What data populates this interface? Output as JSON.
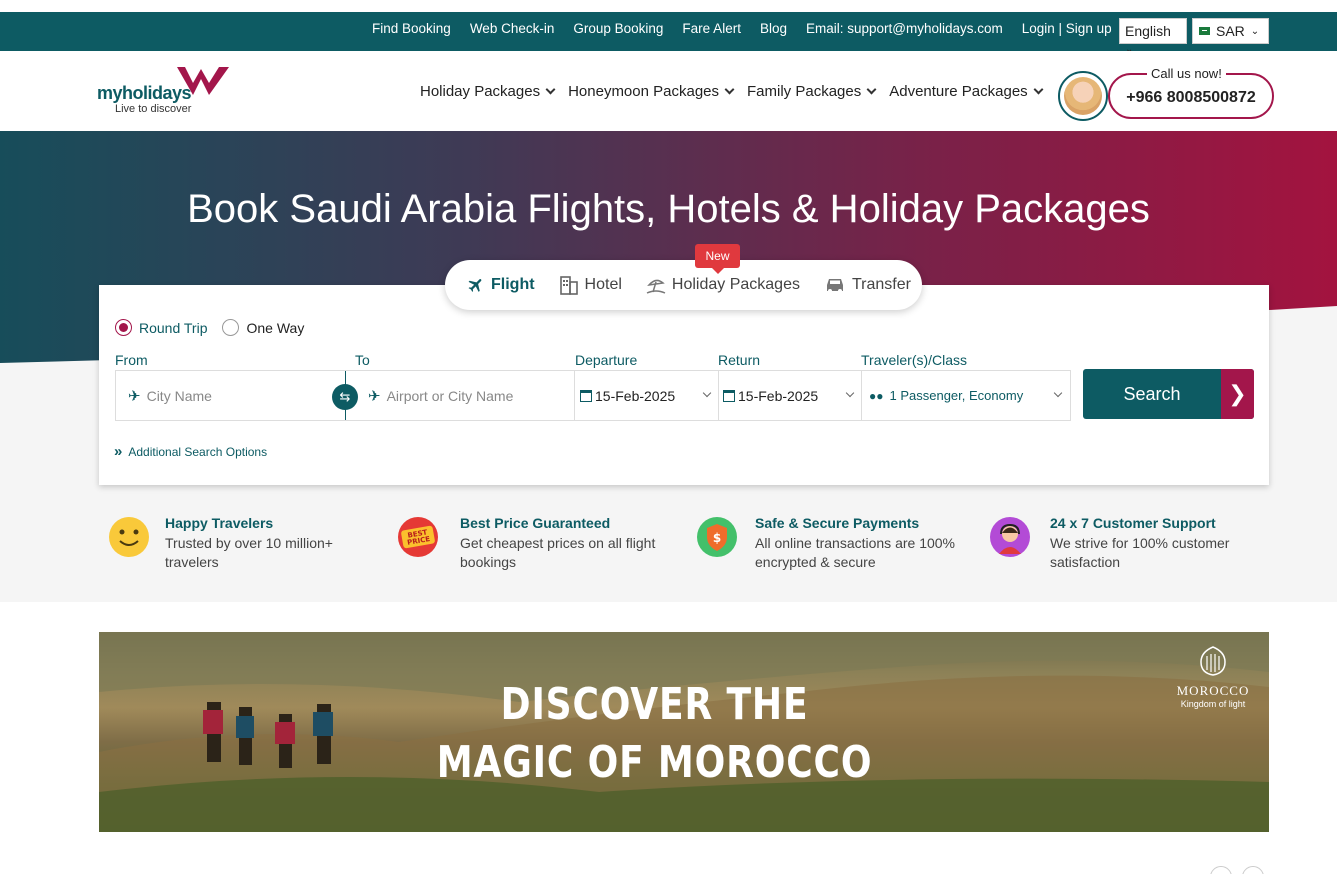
{
  "topbar": {
    "links": [
      "Find Booking",
      "Web Check-in",
      "Group Booking",
      "Fare Alert",
      "Blog",
      "Email:  support@myholidays.com",
      "Login | Sign up"
    ],
    "language": "English",
    "currency": "SAR"
  },
  "header": {
    "logo_text_my": "my",
    "logo_text_holidays": "holidays",
    "logo_tagline": "Live to discover",
    "nav": [
      "Holiday Packages",
      "Honeymoon Packages",
      "Family Packages",
      "Adventure Packages"
    ],
    "call_label": "Call us now!",
    "call_phone": "+966 8008500872"
  },
  "hero": {
    "title": "Book Saudi Arabia Flights, Hotels & Holiday Packages"
  },
  "search": {
    "tabs": [
      {
        "label": "Flight",
        "icon": "plane-icon"
      },
      {
        "label": "Hotel",
        "icon": "building-icon"
      },
      {
        "label": "Holiday Packages",
        "icon": "beach-icon"
      },
      {
        "label": "Transfer",
        "icon": "car-icon"
      }
    ],
    "new_badge": "New",
    "trip_types": [
      "Round Trip",
      "One Way"
    ],
    "labels": {
      "from": "From",
      "to": "To",
      "departure": "Departure",
      "return": "Return",
      "travelers": "Traveler(s)/Class"
    },
    "from_placeholder": "City Name",
    "to_placeholder": "Airport or City Name",
    "departure_value": "15-Feb-2025",
    "return_value": "15-Feb-2025",
    "travelers_value": "1 Passenger, Economy",
    "search_button": "Search",
    "additional": "Additional Search Options"
  },
  "features": [
    {
      "title": "Happy Travelers",
      "desc": "Trusted by over 10 million+ travelers",
      "icon": "smiley-icon"
    },
    {
      "title": "Best Price Guaranteed",
      "desc": "Get cheapest prices on all flight bookings",
      "icon": "best-price-badge-icon"
    },
    {
      "title": "Safe & Secure Payments",
      "desc": "All online transactions are 100% encrypted & secure",
      "icon": "shield-icon"
    },
    {
      "title": "24 x 7 Customer Support",
      "desc": "We strive for 100% customer satisfaction",
      "icon": "support-agent-icon"
    }
  ],
  "banner": {
    "line1": "DISCOVER THE",
    "line2": "MAGIC OF MOROCCO",
    "brand_name": "MOROCCO",
    "brand_sub": "Kingdom of light"
  },
  "colors": {
    "primary": "#0d5b63",
    "accent": "#a3164b"
  }
}
